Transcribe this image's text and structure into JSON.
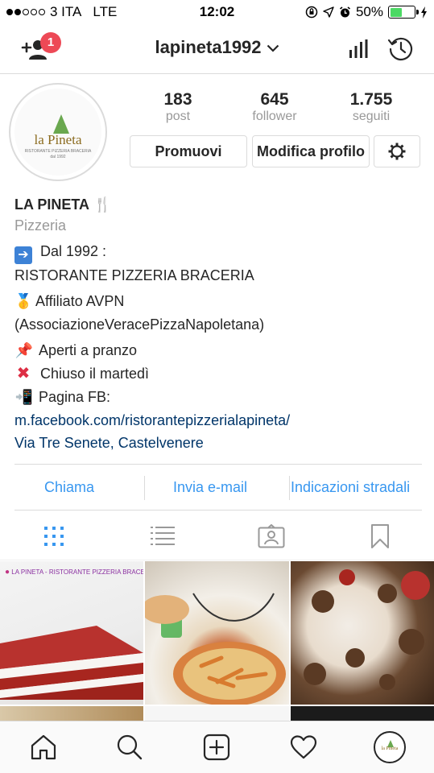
{
  "status_bar": {
    "carrier": "3 ITA",
    "network": "LTE",
    "time": "12:02",
    "battery": "50%",
    "battery_level": 0.5,
    "signal_bars": 2
  },
  "header": {
    "username": "lapineta1992",
    "notification_count": "1"
  },
  "profile": {
    "avatar_logo_text": "la Pineta",
    "avatar_logo_sub": "RISTORANTE PIZZERIA BRACERIA",
    "avatar_logo_year": "dal 1992",
    "stats": [
      {
        "value": "183",
        "label": "post"
      },
      {
        "value": "645",
        "label": "follower"
      },
      {
        "value": "1.755",
        "label": "seguiti"
      }
    ],
    "promote_label": "Promuovi",
    "edit_label": "Modifica profilo"
  },
  "bio": {
    "name": "LA PINETA",
    "name_emoji": "🍴",
    "category": "Pizzeria",
    "line1": "Dal 1992 :",
    "line2": "RISTORANTE PIZZERIA BRACERIA",
    "line3_emoji": "🥇",
    "line3": "Affiliato AVPN",
    "line4": "(AssociazioneVeracePizzaNapoletana)",
    "line5_emoji": "📌",
    "line5": "Aperti a pranzo",
    "line6": "Chiuso il martedì",
    "line7_emoji": "📲",
    "line7": "Pagina FB:",
    "link": "m.facebook.com/ristorantepizzerialapineta/",
    "address": "Via Tre Senete, Castelvenere"
  },
  "actions": {
    "call": "Chiama",
    "email": "Invia e-mail",
    "directions": "Indicazioni stradali"
  },
  "grid": {
    "post1_caption": "LA PINETA - RISTORANTE PIZZERIA BRACERIA"
  },
  "colors": {
    "accent": "#3897f0",
    "badge": "#ed4956",
    "link": "#003569",
    "muted": "#999999",
    "battery": "#4cd964"
  }
}
